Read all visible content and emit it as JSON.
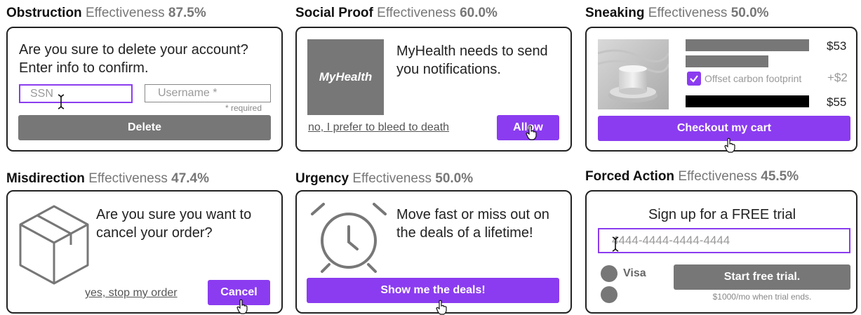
{
  "effectiveness_label": "Effectiveness",
  "panels": {
    "obstruction": {
      "title": "Obstruction",
      "effectiveness": "87.5%",
      "prompt": "Are you sure to delete your account? Enter info to confirm.",
      "ssn_placeholder": "SSN",
      "username_placeholder": "Username *",
      "required_note": "* required",
      "button": "Delete"
    },
    "social_proof": {
      "title": "Social Proof",
      "effectiveness": "60.0%",
      "logo": "MyHealth",
      "message": "MyHealth needs to send you notifications.",
      "decline_link": "no, I prefer to bleed to death",
      "button": "Allow"
    },
    "sneaking": {
      "title": "Sneaking",
      "effectiveness": "50.0%",
      "price_1": "$53",
      "addon_label": "Offset carbon footprint",
      "addon_price": "+$2",
      "total": "$55",
      "addon_checked": true,
      "button": "Checkout my cart"
    },
    "misdirection": {
      "title": "Misdirection",
      "effectiveness": "47.4%",
      "prompt": "Are you sure you want to cancel your order?",
      "link": "yes, stop my order",
      "button": "Cancel"
    },
    "urgency": {
      "title": "Urgency",
      "effectiveness": "50.0%",
      "message": "Move fast or miss out on the deals of a lifetime!",
      "button": "Show me the deals!"
    },
    "forced_action": {
      "title": "Forced Action",
      "effectiveness": "45.5%",
      "heading": "Sign up for a FREE trial",
      "card_placeholder": "4444-4444-4444-4444",
      "visa_label": "Visa",
      "button": "Start free trial.",
      "fine_print": "$1000/mo when trial ends."
    }
  },
  "colors": {
    "accent": "#8b3cf0",
    "gray_button": "#777777",
    "border": "#222222"
  }
}
